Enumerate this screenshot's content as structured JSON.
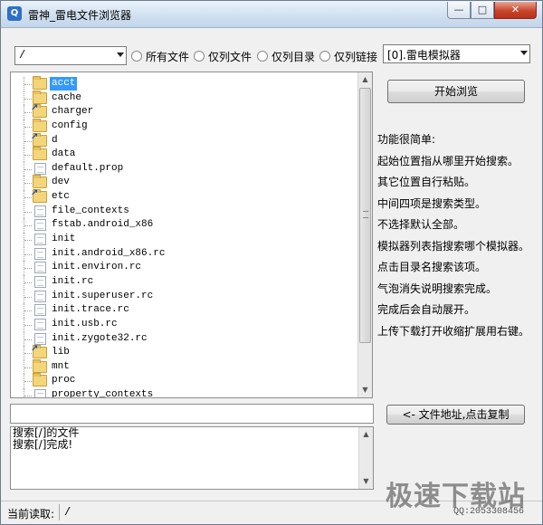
{
  "window": {
    "title": "雷神_雷电文件浏览器",
    "app_icon_glyph": "Q",
    "min_glyph": "—",
    "max_glyph": "□",
    "close_glyph": "✕"
  },
  "toolbar": {
    "path_value": "/",
    "filters": [
      {
        "label": "所有文件"
      },
      {
        "label": "仅列文件"
      },
      {
        "label": "仅列目录"
      },
      {
        "label": "仅列链接"
      }
    ],
    "emulator_value": "[0].雷电模拟器"
  },
  "tree": {
    "items": [
      {
        "label": "acct",
        "icon": "folder-icon",
        "selected": true
      },
      {
        "label": "cache",
        "icon": "folder-icon"
      },
      {
        "label": "charger",
        "icon": "folder-link-icon"
      },
      {
        "label": "config",
        "icon": "folder-icon"
      },
      {
        "label": "d",
        "icon": "folder-link-icon"
      },
      {
        "label": "data",
        "icon": "folder-icon"
      },
      {
        "label": "default.prop",
        "icon": "file-icon"
      },
      {
        "label": "dev",
        "icon": "folder-icon"
      },
      {
        "label": "etc",
        "icon": "folder-link-icon"
      },
      {
        "label": "file_contexts",
        "icon": "file-icon"
      },
      {
        "label": "fstab.android_x86",
        "icon": "file-icon"
      },
      {
        "label": "init",
        "icon": "file-icon"
      },
      {
        "label": "init.android_x86.rc",
        "icon": "file-icon"
      },
      {
        "label": "init.environ.rc",
        "icon": "file-icon"
      },
      {
        "label": "init.rc",
        "icon": "file-icon"
      },
      {
        "label": "init.superuser.rc",
        "icon": "file-icon"
      },
      {
        "label": "init.trace.rc",
        "icon": "file-icon"
      },
      {
        "label": "init.usb.rc",
        "icon": "file-icon"
      },
      {
        "label": "init.zygote32.rc",
        "icon": "file-icon"
      },
      {
        "label": "lib",
        "icon": "folder-link-icon"
      },
      {
        "label": "mnt",
        "icon": "folder-icon"
      },
      {
        "label": "proc",
        "icon": "folder-icon"
      },
      {
        "label": "property_contexts",
        "icon": "file-icon"
      }
    ]
  },
  "buttons": {
    "start_label": "开始浏览",
    "copy_label": "<- 文件地址,点击复制"
  },
  "help": {
    "lines": [
      "功能很简单:",
      "起始位置指从哪里开始搜索。",
      "其它位置自行粘贴。",
      "中间四项是搜索类型。",
      "不选择默认全部。",
      "模拟器列表指搜索哪个模拟器。",
      "点击目录名搜索该项。",
      "气泡消失说明搜索完成。",
      "完成后会自动展开。",
      "上传下载打开收缩扩展用右键。"
    ]
  },
  "address": {
    "value": ""
  },
  "log": {
    "lines": [
      "搜索[/]的文件",
      "搜索[/]完成!"
    ]
  },
  "status": {
    "label": "当前读取:",
    "value": "/",
    "qq": "QQ:2053308456"
  },
  "watermark": {
    "text": "极速下载站"
  }
}
